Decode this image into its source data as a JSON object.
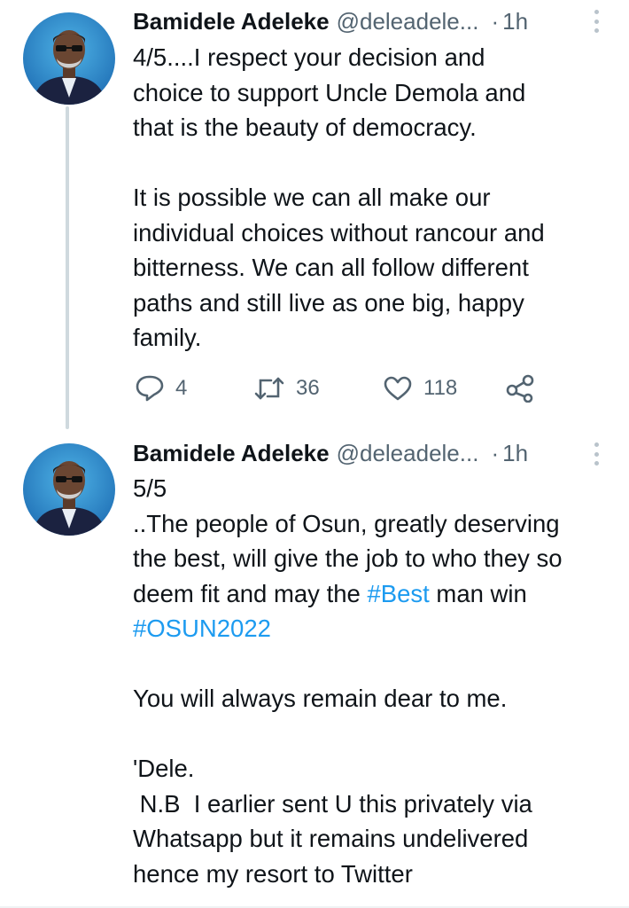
{
  "tweets": [
    {
      "author": {
        "name": "Bamidele Adeleke",
        "handle": "@deleadele..."
      },
      "separator": "·",
      "time": "1h",
      "lines": [
        "4/5....I respect your decision and",
        "choice to support Uncle Demola and",
        "that is the beauty of democracy.",
        "",
        "It is possible we can all make our",
        "individual choices without rancour and",
        "bitterness. We can all follow different",
        "paths and still live as one big, happy",
        "family."
      ],
      "actions": {
        "replies": "4",
        "retweets": "36",
        "likes": "118"
      },
      "icons": [
        "reply-icon",
        "retweet-icon",
        "like-icon",
        "share-icon",
        "more-icon"
      ]
    },
    {
      "author": {
        "name": "Bamidele Adeleke",
        "handle": "@deleadele..."
      },
      "separator": "·",
      "time": "1h",
      "line1": "5/5",
      "line2": "..The people of Osun, greatly deserving",
      "line3": "the best, will give the job to who they so",
      "line4_pre": "deem fit and may the ",
      "line4_tag": "#Best",
      "line4_post": " man win",
      "line5_tag": "#OSUN2022",
      "line7": "You will always remain dear to me.",
      "line9": "'Dele.",
      "line10": " N.B  I earlier sent U this privately via",
      "line11": "Whatsapp but it remains undelivered",
      "line12": "hence my resort to Twitter"
    }
  ],
  "colors": {
    "link": "#1d9bf0",
    "secondary": "#536471",
    "thread_line": "#cfd9de"
  }
}
